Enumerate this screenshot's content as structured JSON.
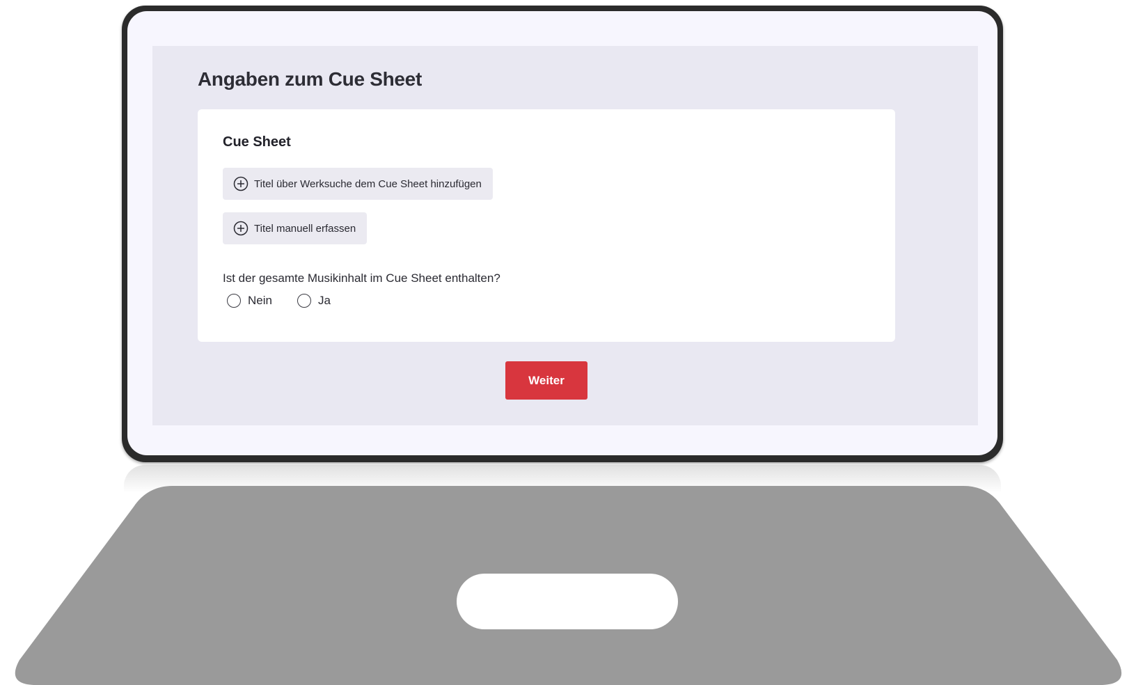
{
  "page": {
    "title": "Angaben zum Cue Sheet"
  },
  "card": {
    "title": "Cue Sheet",
    "add_search_label": "Titel über Werksuche dem Cue Sheet hinzufügen",
    "add_manual_label": "Titel manuell erfassen",
    "question": "Ist der gesamte Musikinhalt im Cue Sheet enthalten?",
    "options": [
      {
        "label": "Nein",
        "selected": false
      },
      {
        "label": "Ja",
        "selected": false
      }
    ]
  },
  "actions": {
    "next_label": "Weiter"
  },
  "icons": {
    "add": "plus-circle-icon"
  },
  "colors": {
    "accent": "#d8363e",
    "screen_bg": "#e9e8f2",
    "card_bg": "#ffffff",
    "laptop_frame": "#2b2b2b",
    "laptop_base": "#9a9a9a"
  }
}
